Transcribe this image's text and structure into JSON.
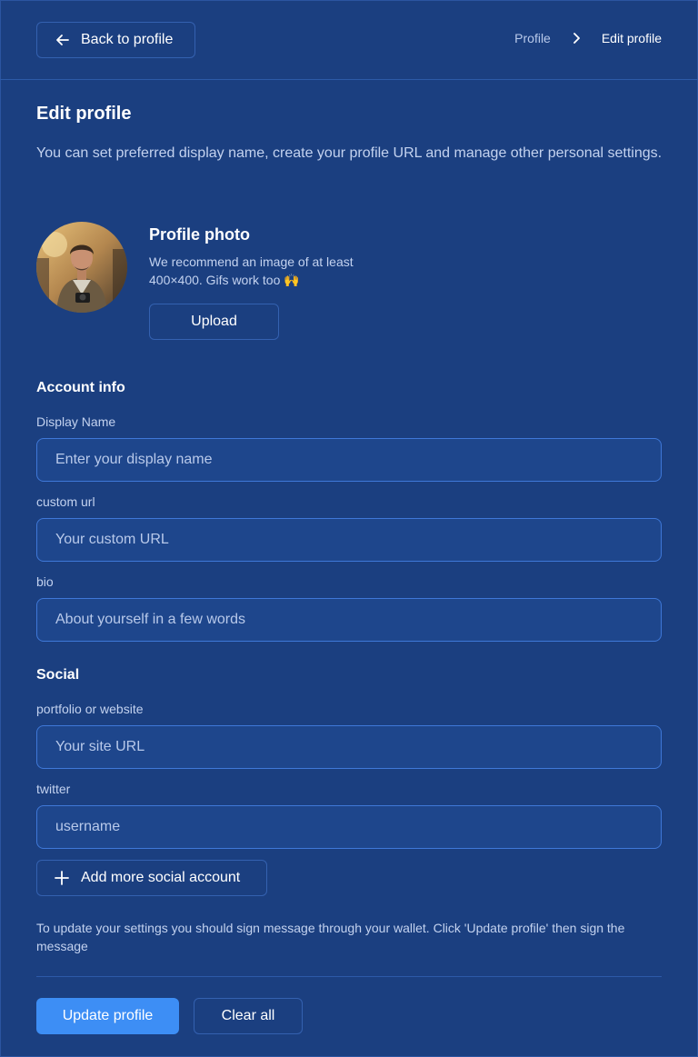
{
  "header": {
    "back_label": "Back to profile",
    "breadcrumb": [
      "Profile",
      "Edit profile"
    ]
  },
  "page": {
    "title": "Edit profile",
    "intro": "You can set preferred display name, create your profile URL and manage other personal settings."
  },
  "photo": {
    "title": "Profile photo",
    "hint": "We recommend an image of at least 400×400. Gifs work too 🙌",
    "upload_label": "Upload"
  },
  "account": {
    "section_title": "Account info",
    "fields": [
      {
        "label": "Display Name",
        "placeholder": "Enter your display name",
        "value": ""
      },
      {
        "label": "custom url",
        "placeholder": "Your custom URL",
        "value": ""
      },
      {
        "label": "bio",
        "placeholder": "About yourself in a few words",
        "value": ""
      }
    ]
  },
  "social": {
    "section_title": "Social",
    "fields": [
      {
        "label": "portfolio or website",
        "placeholder": "Your site URL",
        "value": ""
      },
      {
        "label": "twitter",
        "placeholder": "username",
        "value": ""
      }
    ],
    "add_label": "Add more social account"
  },
  "footer": {
    "note": "To update your settings you should sign message through your wallet. Click 'Update profile' then sign the message",
    "update_label": "Update profile",
    "clear_label": "Clear all"
  },
  "colors": {
    "background": "#1b3f80",
    "accent": "#3d8ef5",
    "input_border": "#3f78d8"
  },
  "icons": {
    "back": "arrow-left-icon",
    "breadcrumb_separator": "chevron-right-icon",
    "add": "plus-icon"
  }
}
